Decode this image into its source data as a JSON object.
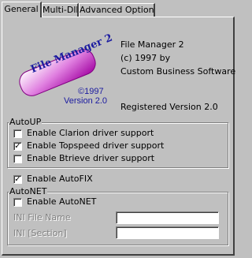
{
  "tabs": [
    {
      "label": "General",
      "active": true
    },
    {
      "label": "Multi-Dll",
      "active": false
    },
    {
      "label": "Advanced Options",
      "active": false
    }
  ],
  "logo": {
    "text": "File Manager 2",
    "copyright": "©1997",
    "version": "Version 2.0",
    "fill_colors": [
      "#ffffff",
      "#e080e0",
      "#a000a0"
    ],
    "text_color": "#1a1aa0"
  },
  "about": {
    "product": "File Manager 2",
    "copyright": "(c) 1997 by",
    "company": "Custom Business Software",
    "registered": "Registered Version 2.0"
  },
  "autoup": {
    "label": "AutoUP",
    "options": [
      {
        "label": "Enable Clarion driver support",
        "checked": false
      },
      {
        "label": "Enable Topspeed driver support",
        "checked": true
      },
      {
        "label": "Enable Btrieve driver support",
        "checked": false
      }
    ]
  },
  "autofix": {
    "label": "Enable AutoFIX",
    "checked": true
  },
  "autonet": {
    "label": "AutoNET",
    "enable": {
      "label": "Enable AutoNET",
      "checked": false
    },
    "ini_file_label": "INI File Name",
    "ini_file_value": "",
    "ini_section_label": "INI [Section]",
    "ini_section_value": ""
  }
}
